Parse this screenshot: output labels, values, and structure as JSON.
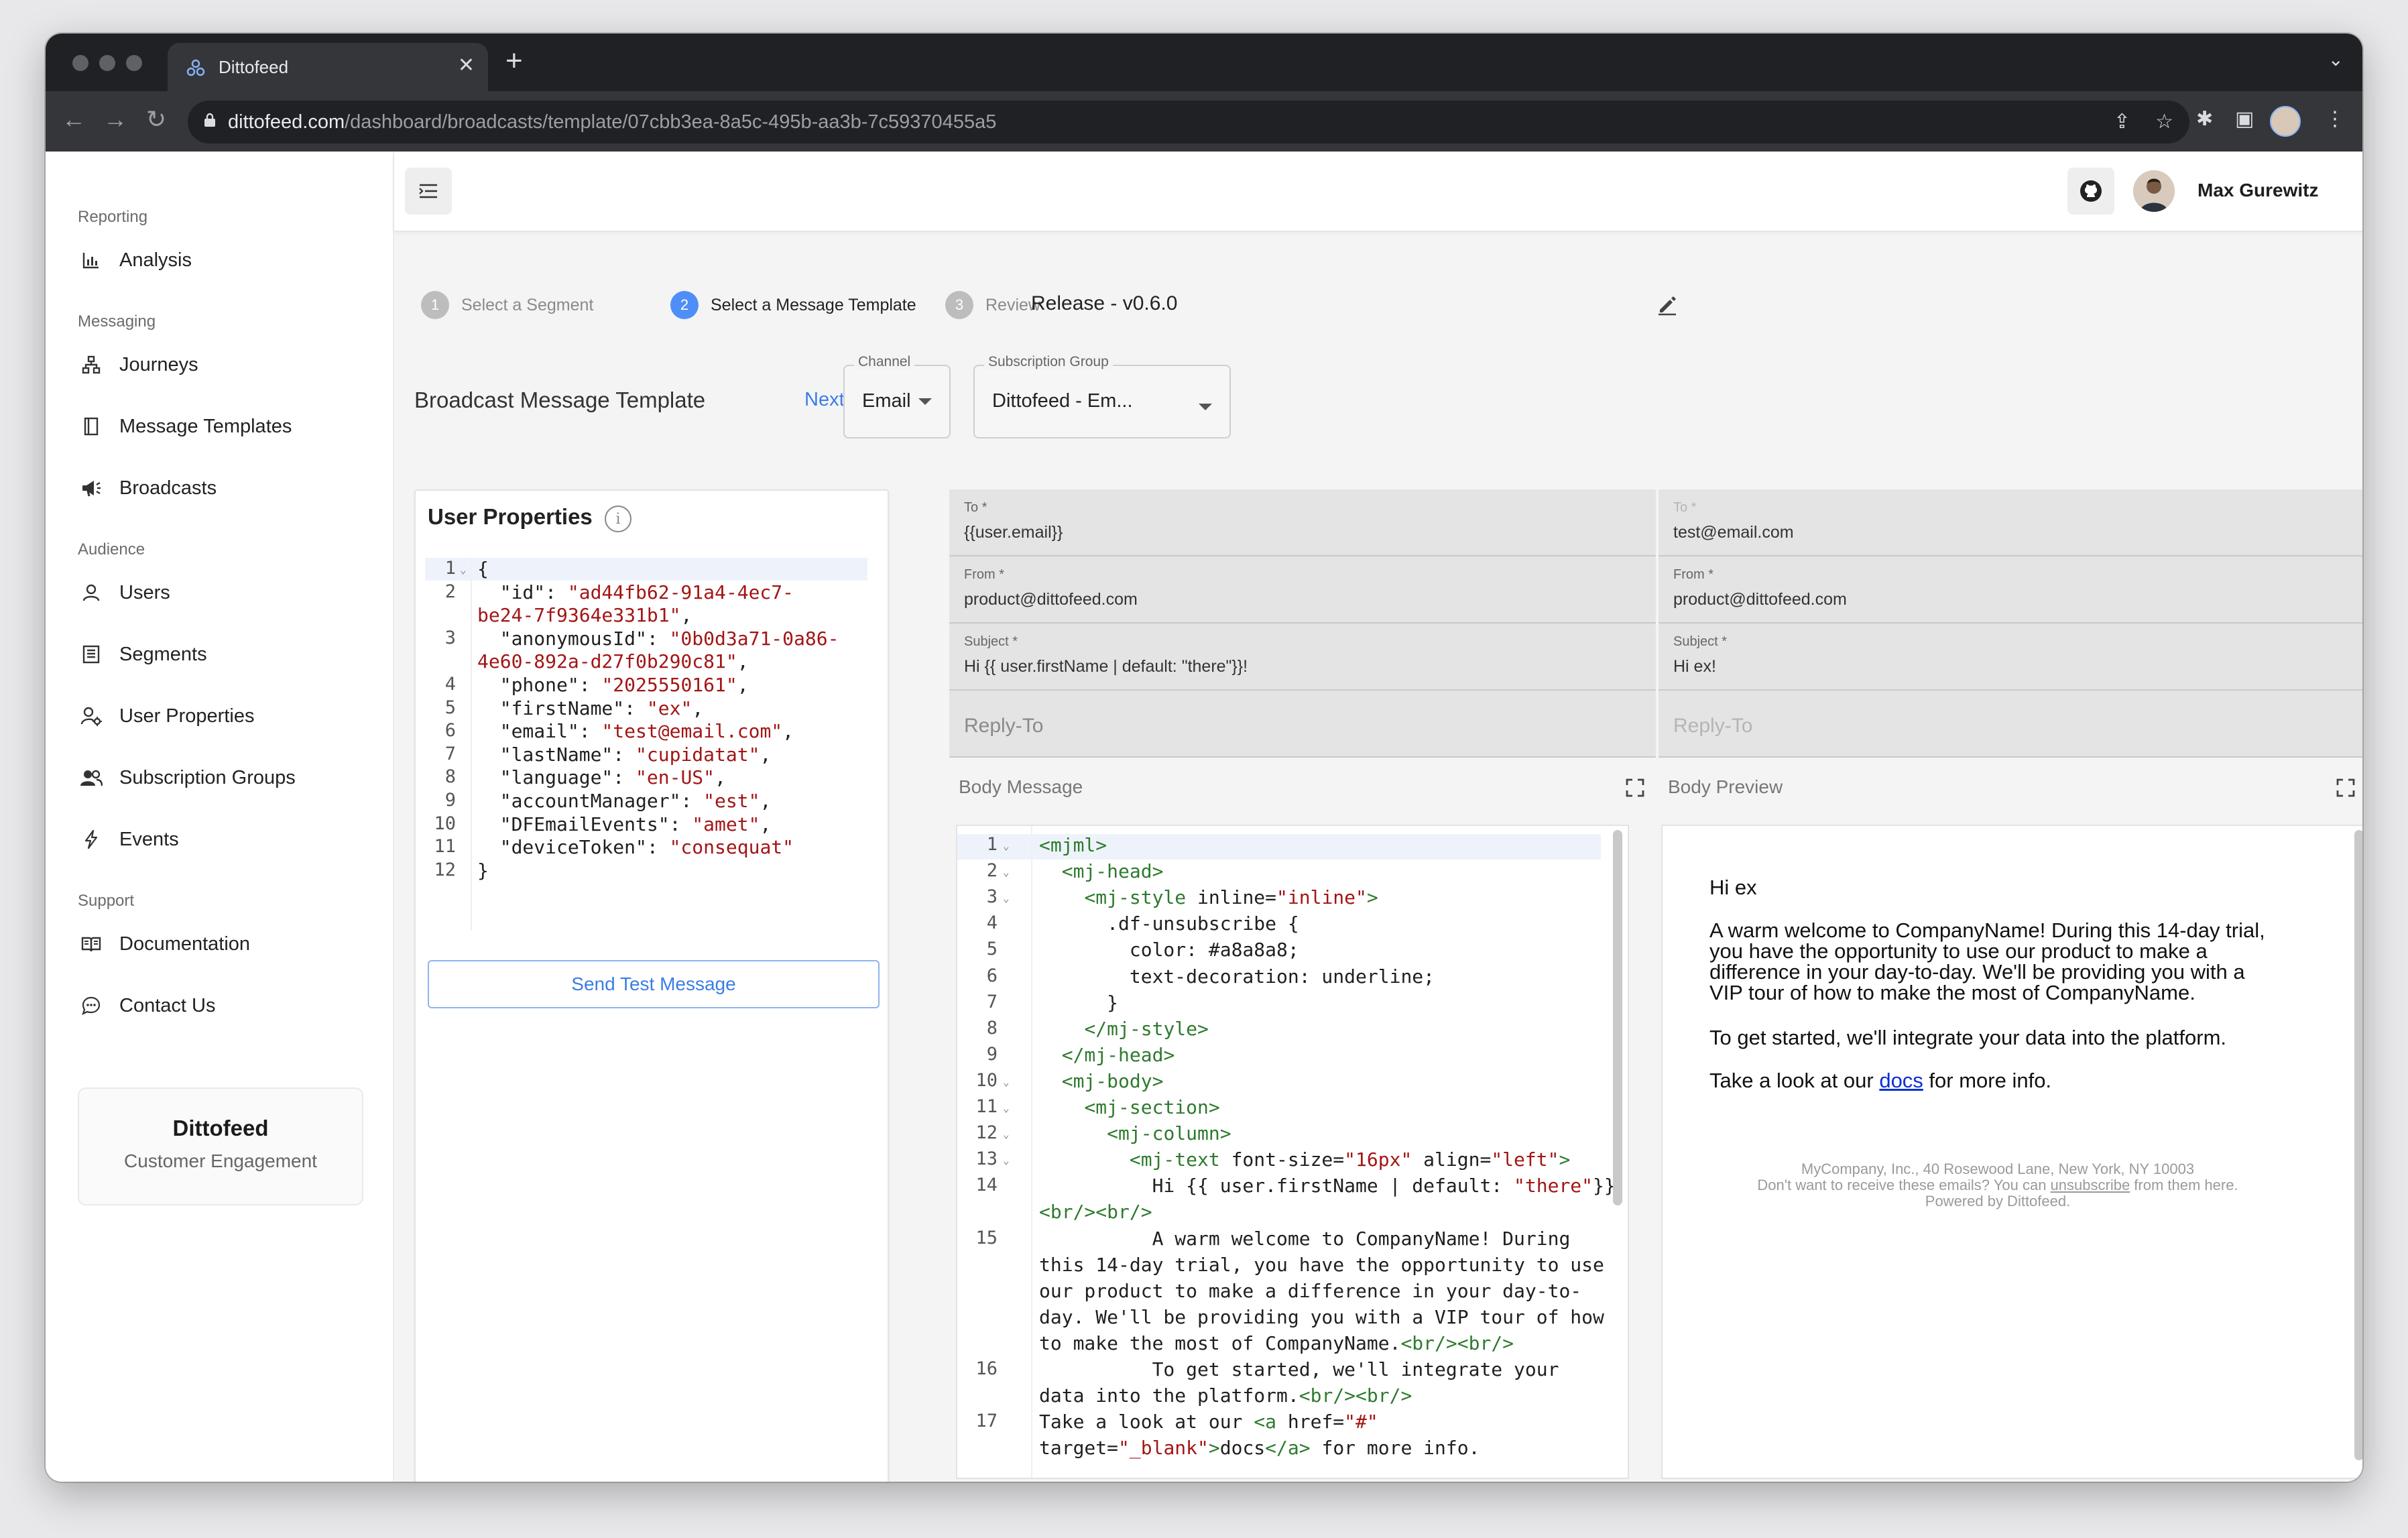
{
  "browser": {
    "tab_title": "Dittofeed",
    "url_host": "dittofeed.com",
    "url_path": "/dashboard/broadcasts/template/07cbb3ea-8a5c-495b-aa3b-7c59370455a5"
  },
  "sidebar": {
    "groups": {
      "reporting": "Reporting",
      "messaging": "Messaging",
      "audience": "Audience",
      "support": "Support"
    },
    "items": {
      "analysis": "Analysis",
      "journeys": "Journeys",
      "message_templates": "Message Templates",
      "broadcasts": "Broadcasts",
      "users": "Users",
      "segments": "Segments",
      "user_properties": "User Properties",
      "subscription_groups": "Subscription Groups",
      "events": "Events",
      "documentation": "Documentation",
      "contact_us": "Contact Us"
    },
    "org": {
      "name": "Dittofeed",
      "subtitle": "Customer Engagement"
    }
  },
  "header": {
    "user_name": "Max Gurewitz"
  },
  "stepper": {
    "steps": [
      {
        "number": "1",
        "label": "Select a Segment"
      },
      {
        "number": "2",
        "label": "Select a Message Template"
      },
      {
        "number": "3",
        "label": "Review"
      }
    ],
    "active_step": 2,
    "release_name": "Release - v0.6.0"
  },
  "template_bar": {
    "title": "Broadcast Message Template",
    "next_label": "Next",
    "channel_label": "Channel",
    "channel_value": "Email",
    "subscription_group_label": "Subscription Group",
    "subscription_group_value": "Dittofeed - Em..."
  },
  "user_properties": {
    "title": "User Properties",
    "info_glyph": "i",
    "send_test_label": "Send Test Message",
    "line_numbers": [
      "1",
      "2",
      "",
      "3",
      "",
      "4",
      "5",
      "6",
      "7",
      "8",
      "9",
      "10",
      "11",
      "12"
    ],
    "lines": [
      {
        "k": "{",
        "v": ""
      },
      {
        "k": "  \"id\": ",
        "v": "\"ad44fb62-91a4-4ec7-"
      },
      {
        "k": "",
        "v": "be24-7f9364e331b1\"",
        "tail": ","
      },
      {
        "k": "  \"anonymousId\": ",
        "v": "\"0b0d3a71-0a86-"
      },
      {
        "k": "",
        "v": "4e60-892a-d27f0b290c81\"",
        "tail": ","
      },
      {
        "k": "  \"phone\": ",
        "v": "\"2025550161\"",
        "tail": ","
      },
      {
        "k": "  \"firstName\": ",
        "v": "\"ex\"",
        "tail": ","
      },
      {
        "k": "  \"email\": ",
        "v": "\"test@email.com\"",
        "tail": ","
      },
      {
        "k": "  \"lastName\": ",
        "v": "\"cupidatat\"",
        "tail": ","
      },
      {
        "k": "  \"language\": ",
        "v": "\"en-US\"",
        "tail": ","
      },
      {
        "k": "  \"accountManager\": ",
        "v": "\"est\"",
        "tail": ","
      },
      {
        "k": "  \"DFEmailEvents\": ",
        "v": "\"amet\"",
        "tail": ","
      },
      {
        "k": "  \"deviceToken\": ",
        "v": "\"consequat\""
      },
      {
        "k": "}",
        "v": ""
      }
    ]
  },
  "email_fields": {
    "to_label": "To *",
    "to_value": "{{user.email}}",
    "to_preview": "test@email.com",
    "from_label": "From *",
    "from_value": "product@dittofeed.com",
    "from_preview": "product@dittofeed.com",
    "subject_label": "Subject *",
    "subject_value": "Hi {{ user.firstName | default: \"there\"}}!",
    "subject_preview": "Hi ex!",
    "reply_to_placeholder": "Reply-To"
  },
  "body_message": {
    "label": "Body Message",
    "preview_label": "Body Preview",
    "line_numbers": [
      "1",
      "2",
      "3",
      "4",
      "5",
      "6",
      "7",
      "8",
      "9",
      "10",
      "11",
      "12",
      "13",
      "14",
      "",
      "15",
      "",
      "",
      "",
      "",
      "16",
      "",
      "17",
      ""
    ],
    "lines": [
      "<mjml>",
      "  <mj-head>",
      "    <mj-style inline=\"inline\">",
      "      .df-unsubscribe {",
      "        color: #a8a8a8;",
      "        text-decoration: underline;",
      "      }",
      "    </mj-style>",
      "  </mj-head>",
      "  <mj-body>",
      "    <mj-section>",
      "      <mj-column>",
      "        <mj-text font-size=\"16px\" align=\"left\">",
      "          Hi {{ user.firstName | default: \"there\"}}",
      "<br/><br/>",
      "          A warm welcome to CompanyName! During",
      "this 14-day trial, you have the opportunity to use",
      "our product to make a difference in your day-to-",
      "day. We'll be providing you with a VIP tour of how",
      "to make the most of CompanyName.<br/><br/>",
      "          To get started, we'll integrate your",
      "data into the platform.<br/><br/>",
      "Take a look at our <a href=\"#\"",
      "target=\"_blank\">docs</a> for more info."
    ]
  },
  "preview": {
    "greeting": "Hi ex",
    "para1_lines": [
      "A warm welcome to CompanyName! During this 14-day trial,",
      "you have the opportunity to use our product to make a",
      "difference in your day-to-day. We'll be providing you with a",
      "VIP tour of how to make the most of CompanyName."
    ],
    "para2": "To get started, we'll integrate your data into the platform.",
    "para3_before": "Take a look at our ",
    "para3_link": "docs",
    "para3_after": " for more info.",
    "footer_address": "MyCompany, Inc., 40 Rosewood Lane, New York, NY 10003",
    "footer_unsub_before": "Don't want to receive these emails? You can ",
    "footer_unsub_link": "unsubscribe",
    "footer_unsub_after": " from them here.",
    "footer_powered": "Powered by Dittofeed."
  },
  "colors": {
    "accent": "#3b7de4",
    "step_active": "#4f8ef7",
    "string_token": "#a31515",
    "tag_token": "#2e7a2e"
  }
}
